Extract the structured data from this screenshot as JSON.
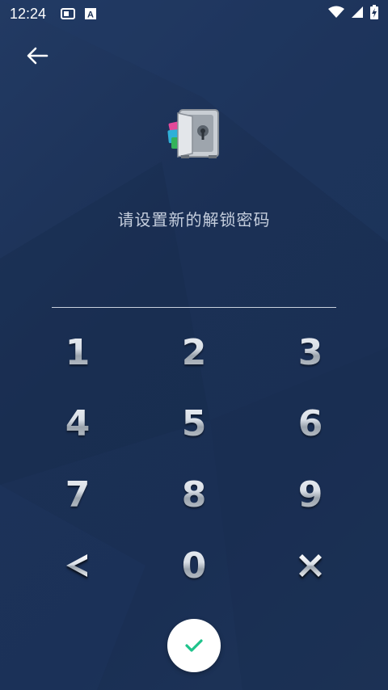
{
  "status_bar": {
    "time": "12:24",
    "icons": [
      "screenshot-icon",
      "keyboard-a-icon",
      "wifi-icon",
      "signal-icon",
      "battery-charging-icon"
    ]
  },
  "header": {
    "back_icon": "arrow-left-icon",
    "logo_icon": "app-lock-safe-icon"
  },
  "prompt": {
    "text": "请设置新的解锁密码"
  },
  "pin_field": {
    "value": ""
  },
  "keypad": {
    "keys": [
      "1",
      "2",
      "3",
      "4",
      "5",
      "6",
      "7",
      "8",
      "9",
      "<",
      "0",
      "×"
    ],
    "backspace_icon": "chevron-left-icon",
    "clear_icon": "close-icon"
  },
  "confirm": {
    "icon": "check-icon",
    "color": "#1ec38b"
  },
  "colors": {
    "background": "#1c3156",
    "prompt_text": "#c5cedd"
  }
}
